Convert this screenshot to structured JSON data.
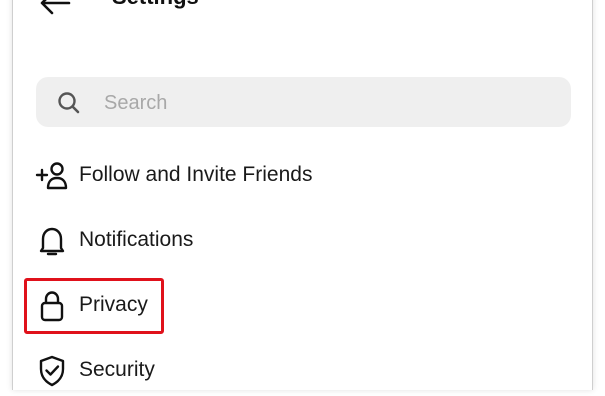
{
  "header": {
    "title": "Settings",
    "back_icon": "back-arrow-icon"
  },
  "search": {
    "placeholder": "Search",
    "value": "",
    "icon": "search-icon"
  },
  "menu": {
    "items": [
      {
        "label": "Follow and Invite Friends",
        "icon": "add-person-icon"
      },
      {
        "label": "Notifications",
        "icon": "bell-icon"
      },
      {
        "label": "Privacy",
        "icon": "lock-icon",
        "highlighted": true
      },
      {
        "label": "Security",
        "icon": "shield-check-icon"
      }
    ]
  },
  "colors": {
    "highlight": "#e0111b",
    "search_bg": "#efefef",
    "placeholder": "#a8a8a8"
  }
}
